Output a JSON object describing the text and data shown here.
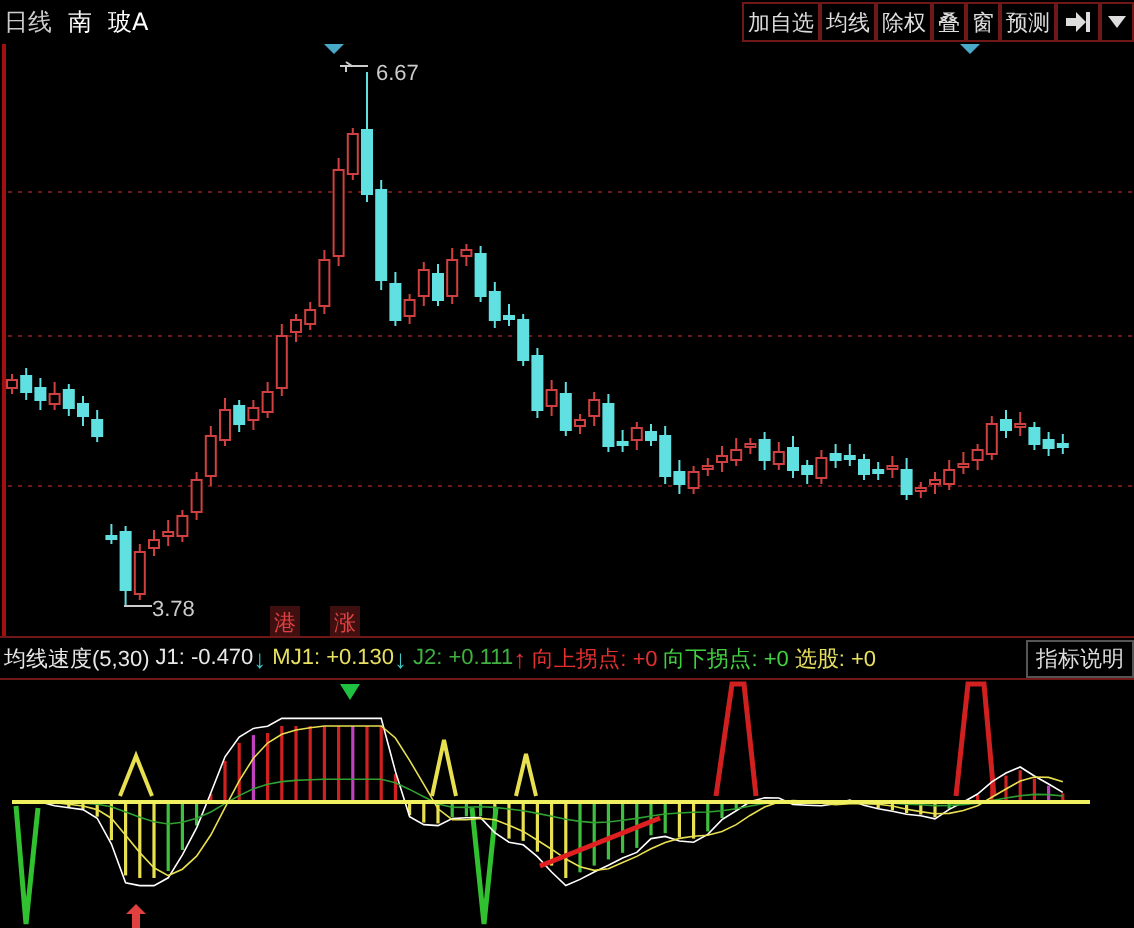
{
  "toolbar": {
    "period": "日线",
    "stock_name": [
      "南",
      "玻A"
    ],
    "buttons": [
      "加自选",
      "均线",
      "除权",
      "叠",
      "窗",
      "预测"
    ]
  },
  "price_chart": {
    "high_label": "6.67",
    "low_label": "3.78",
    "markers": [
      "港",
      "涨"
    ]
  },
  "indicator": {
    "name": "均线速度(5,30)",
    "items": [
      {
        "label": "J1: -0.470",
        "color": "#e8e8e8"
      },
      {
        "label": "↓",
        "color": "#40c8c8",
        "kind": "arrow"
      },
      {
        "label": "MJ1: +0.130",
        "color": "#e8e060"
      },
      {
        "label": "↓",
        "color": "#40c8c8",
        "kind": "arrow"
      },
      {
        "label": "J2: +0.111",
        "color": "#40b040"
      },
      {
        "label": "↑",
        "color": "#e03030",
        "kind": "arrow"
      },
      {
        "label": "向上拐点: +0",
        "color": "#e03030"
      },
      {
        "label": "向下拐点: +0",
        "color": "#40d040"
      },
      {
        "label": "选股: +0",
        "color": "#e8e060"
      }
    ],
    "help_button": "指标说明"
  }
}
